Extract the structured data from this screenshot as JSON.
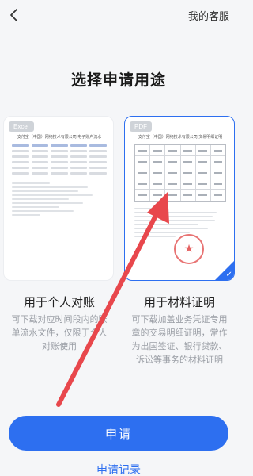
{
  "header": {
    "back_icon": "chevron-left-icon",
    "service_label": "我的客服"
  },
  "page": {
    "title": "选择申请用途"
  },
  "options": [
    {
      "file_type": "Excel",
      "doc_title": "支付宝（中国）网络技术有限公司  电子账户流水",
      "label": "用于个人对账",
      "description": "可下载对应时间段内的账单流水文件，仅限于个人对账使用",
      "selected": false
    },
    {
      "file_type": "PDF",
      "doc_title": "支付宝（中国）网络技术有限公司  交易明细证明",
      "label": "用于材料证明",
      "description": "可下载加盖业务凭证专用章的交易明细证明，常作为出国签证、银行贷款、诉讼等事务的材料证明",
      "selected": true
    }
  ],
  "actions": {
    "apply_label": "申请",
    "records_label": "申请记录"
  },
  "colors": {
    "accent": "#2d6ff0",
    "annotation_arrow": "#e8474c"
  }
}
